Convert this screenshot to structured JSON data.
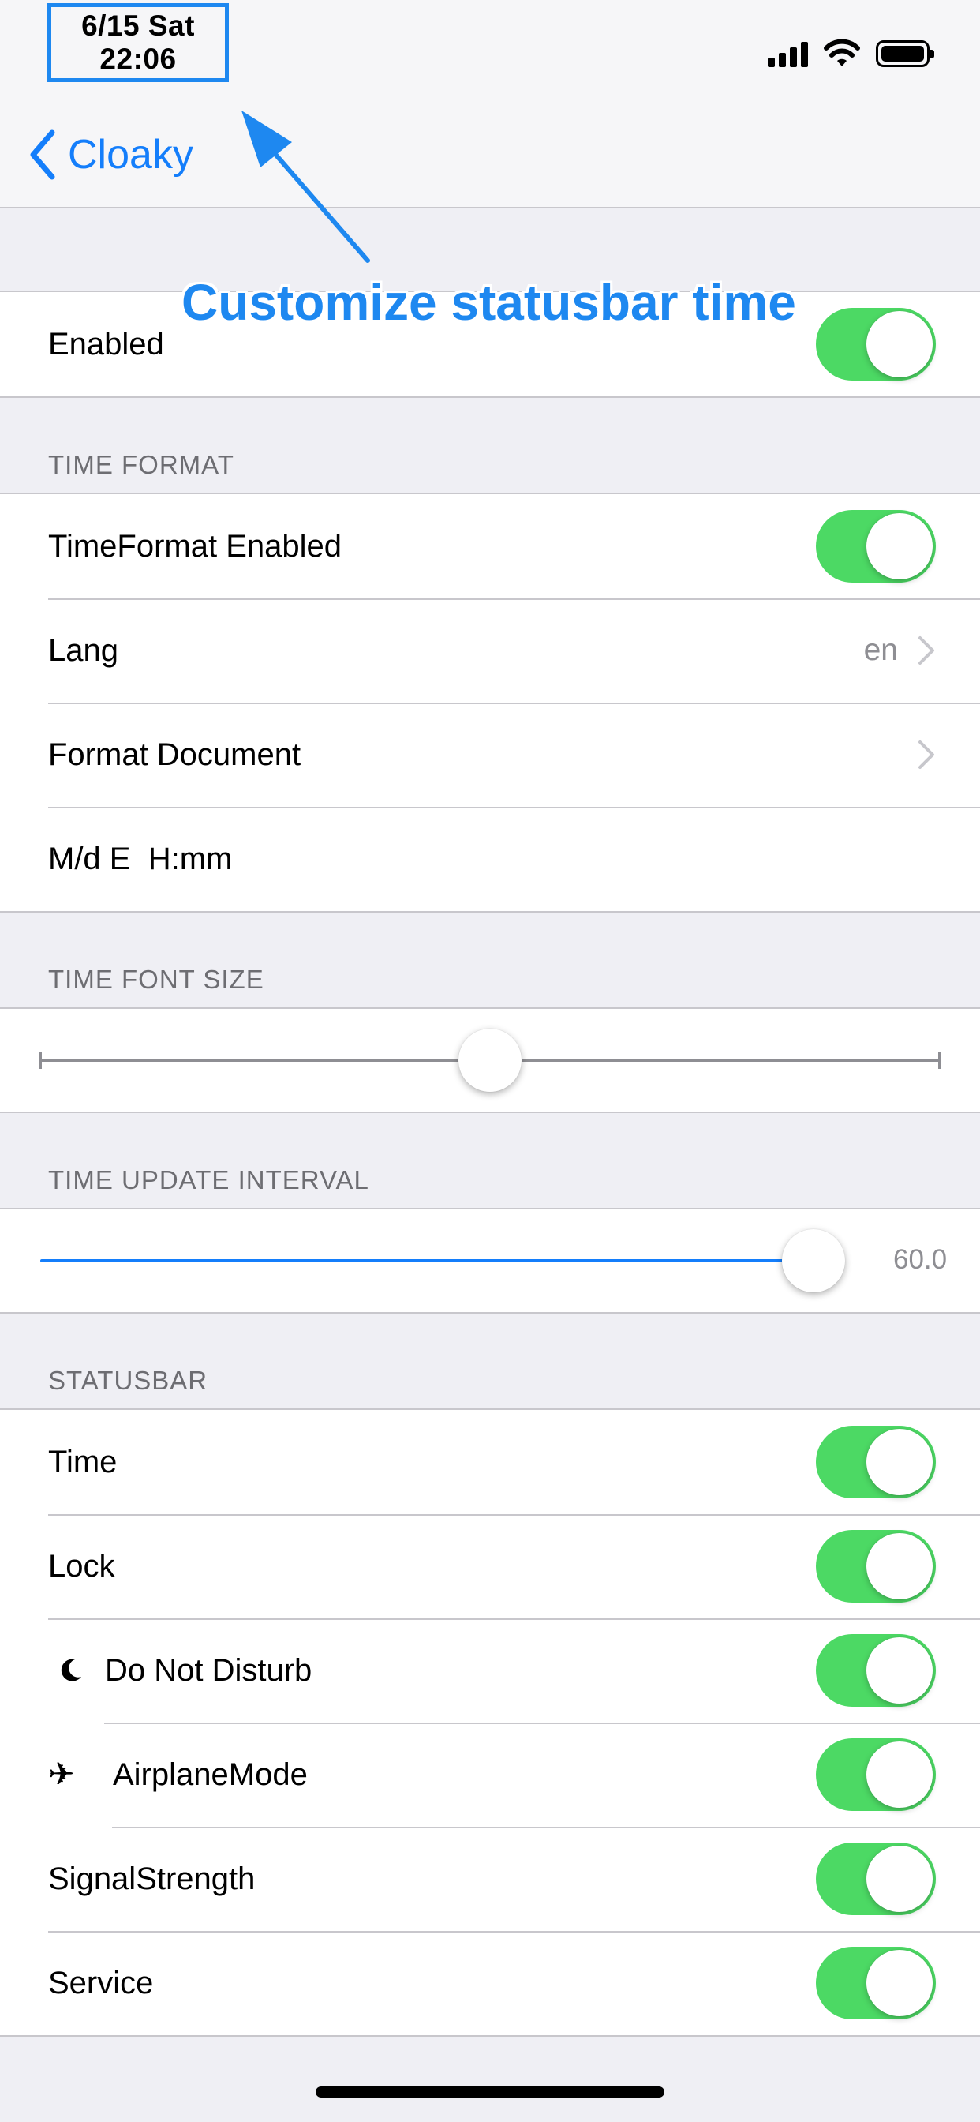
{
  "status_bar": {
    "date": "6/15 Sat",
    "time": "22:06"
  },
  "nav": {
    "back_label": "Cloaky"
  },
  "annotation": {
    "text": "Customize statusbar time",
    "color": "#1e88f0"
  },
  "main_group": {
    "enabled_label": "Enabled",
    "enabled_on": true
  },
  "time_format": {
    "header": "TIME FORMAT",
    "rows": {
      "enabled_label": "TimeFormat Enabled",
      "lang_label": "Lang",
      "lang_value": "en",
      "doc_label": "Format Document",
      "format_value": "M/d E  H:mm"
    }
  },
  "time_font_size": {
    "header": "TIME FONT SIZE",
    "slider_fraction": 0.5
  },
  "time_update_interval": {
    "header": "TIME UPDATE INTERVAL",
    "value_label": "60.0",
    "slider_fraction": 0.97
  },
  "statusbar": {
    "header": "STATUSBAR",
    "items": [
      {
        "label": "Time",
        "icon": "",
        "on": true
      },
      {
        "label": "Lock",
        "icon": "",
        "on": true
      },
      {
        "label": "Do Not Disturb",
        "icon": "moon-icon",
        "on": true
      },
      {
        "label": "AirplaneMode",
        "icon": "airplane-icon",
        "on": true
      },
      {
        "label": "SignalStrength",
        "icon": "",
        "on": true
      },
      {
        "label": "Service",
        "icon": "",
        "on": true
      }
    ]
  },
  "colors": {
    "accent": "#147efb",
    "toggle_on": "#4cd964",
    "group_bg": "#efeff4"
  }
}
